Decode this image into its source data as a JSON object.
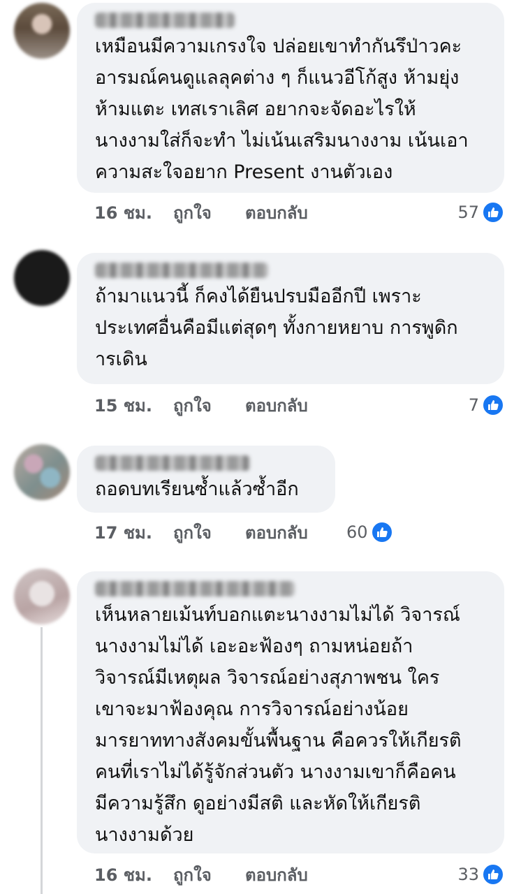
{
  "comments": [
    {
      "text": "เหมือนมีความเกรงใจ ปล่อยเขาทำกันรึป่าวคะ\nอารมณ์คนดูแลลุคต่าง ๆ ก็แนวอีโก้สูง ห้ามยุ่ง\nห้ามแตะ เทสเราเลิศ อยากจะจัดอะไรให้\nนางงามใส่ก็จะทำ ไม่เน้นเสริมนางงาม เน้นเอา\nความสะใจอยาก Present งานตัวเอง",
      "time": "16 ชม.",
      "like_label": "ถูกใจ",
      "reply_label": "ตอบกลับ",
      "reaction_count": "57"
    },
    {
      "text": "ถ้ามาแนวนี้ ก็คงได้ยืนปรบมืออีกปี เพราะ\nประเทศอื่นคือมีแต่สุดๆ ทั้งกายหยาบ การพูดิก\nารเดิน",
      "time": "15 ชม.",
      "like_label": "ถูกใจ",
      "reply_label": "ตอบกลับ",
      "reaction_count": "7"
    },
    {
      "text": "ถอดบทเรียนซ้ำแล้วซ้ำอีก",
      "time": "17 ชม.",
      "like_label": "ถูกใจ",
      "reply_label": "ตอบกลับ",
      "reaction_count": "60"
    },
    {
      "text": "เห็นหลายเม้นท์บอกแตะนางงามไม่ได้ วิจารณ์\nนางงามไม่ได้  เอะอะฟ้องๆ ถามหน่อยถ้า\nวิจารณ์มีเหตุผล วิจารณ์อย่างสุภาพชน ใคร\nเขาจะมาฟ้องคุณ การวิจารณ์อย่างน้อย\nมารยาททางสังคมขั้นพื้นฐาน คือควรให้เกียรติ\nคนที่เราไม่ได้รู้จักส่วนตัว นางงามเขาก็คือคน\nมีความรู้สึก ดูอย่างมีสติ และหัดให้เกียรติ\nนางงามด้วย",
      "time": "16 ชม.",
      "like_label": "ถูกใจ",
      "reply_label": "ตอบกลับ",
      "reaction_count": "33"
    }
  ],
  "colors": {
    "bubble": "#f0f2f5",
    "text": "#111111",
    "meta": "#5b5e63",
    "like_blue": "#1877f2"
  },
  "icons": {
    "reaction": "thumbs-up-icon"
  }
}
